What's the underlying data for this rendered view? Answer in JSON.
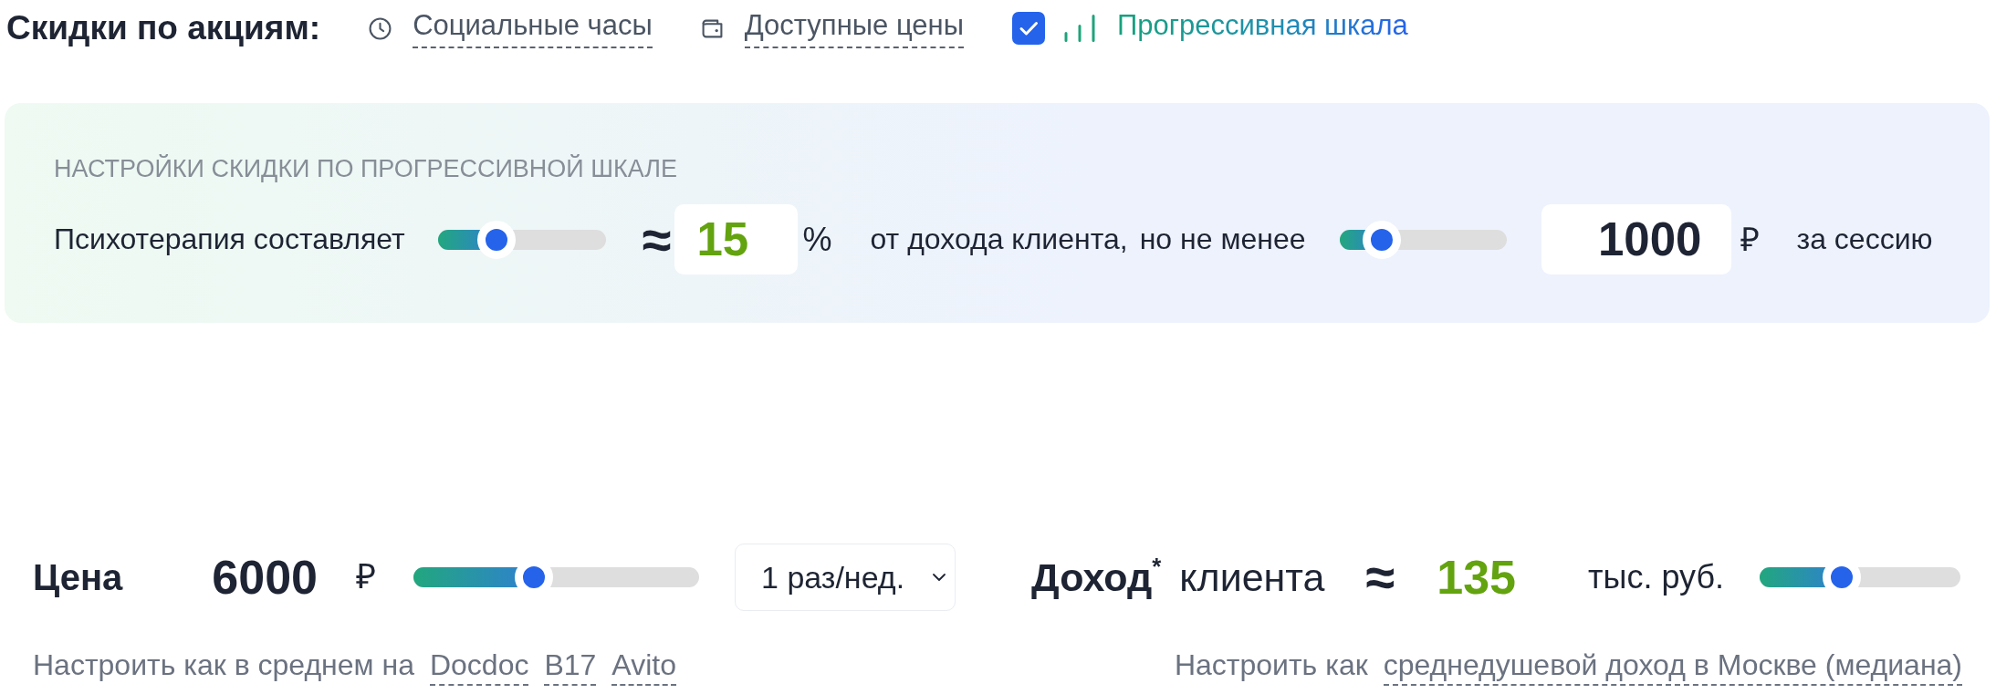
{
  "promotions": {
    "title": "Скидки по акциям:",
    "options": [
      {
        "label": "Социальные часы",
        "selected": false
      },
      {
        "label": "Доступные цены",
        "selected": false
      },
      {
        "label": "Прогрессивная шкала",
        "selected": true
      }
    ]
  },
  "progressive_scale": {
    "title": "НАСТРОЙКИ СКИДКИ ПО ПРОГРЕССИВНОЙ ШКАЛЕ",
    "label": "Психотерапия составляет",
    "percent_slider": {
      "level": 0.35
    },
    "approx": "≈",
    "percent": {
      "value": "15",
      "unit": "%"
    },
    "income_text": "от дохода клиента,",
    "minimum_text": "но не менее",
    "minimum_slider": {
      "level": 0.25
    },
    "minimum": {
      "value": "1000",
      "unit": "₽"
    },
    "suffix": "за сессию"
  },
  "price": {
    "label": "Цена",
    "value": "6000",
    "unit": "₽",
    "slider": {
      "level": 0.42
    },
    "frequency": "1 раз/нед.",
    "hint": "Настроить как в среднем на",
    "sources": [
      "Docdoc",
      "B17",
      "Avito"
    ]
  },
  "income": {
    "label": "**Доход**$^{*}$ клиента",
    "approx": "≈",
    "value": "135",
    "unit": "тыс. руб.",
    "slider": {
      "level": 0.41
    },
    "hint": "Настроить как",
    "source": "среднедушевой доход в Москве (медиана)"
  }
}
